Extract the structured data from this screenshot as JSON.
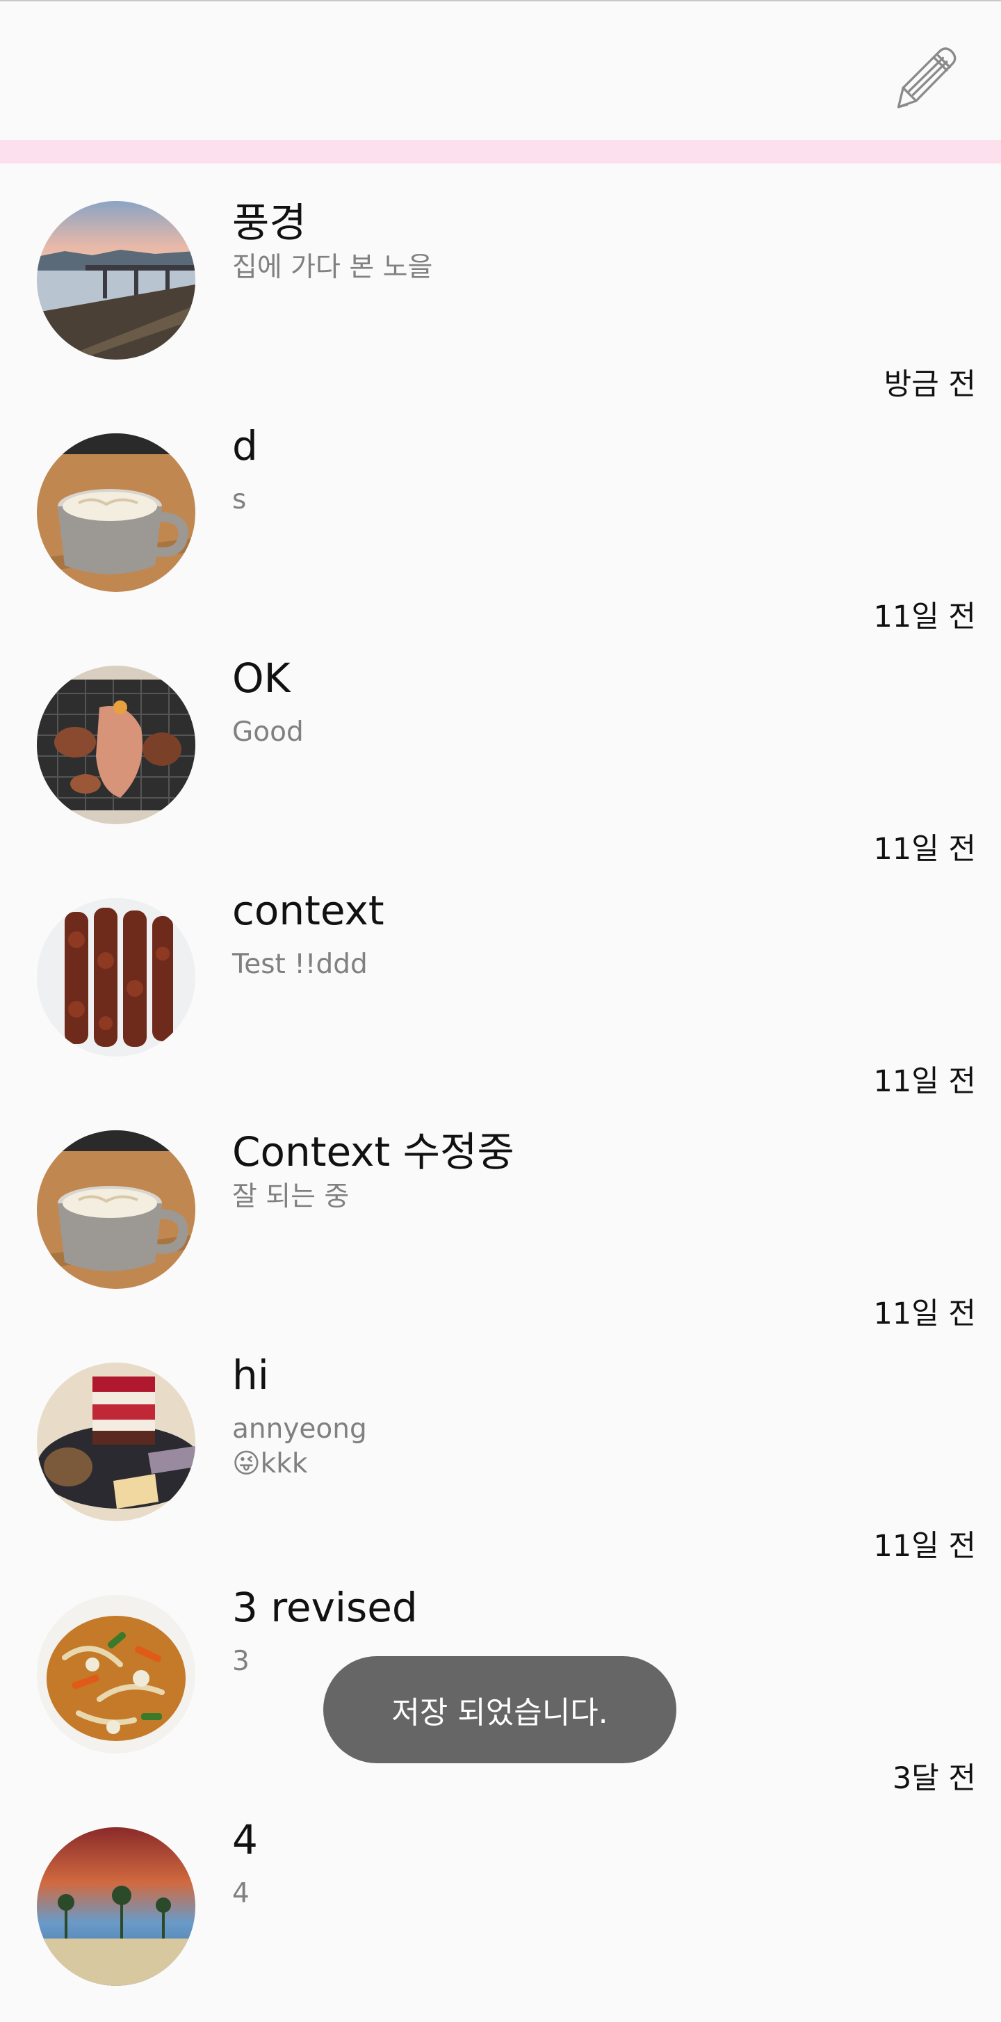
{
  "header": {
    "edit_icon": "pencil-icon"
  },
  "colors": {
    "accent_bar": "#fde0ee",
    "background": "#fafafa",
    "toast": "#666666",
    "subtitle": "#808080"
  },
  "posts": [
    {
      "title": "풍경",
      "content": "집에 가다 본 노을",
      "time": "방금 전",
      "image": "sunset-bridge-photo"
    },
    {
      "title": "d",
      "content": "s",
      "time": "11일 전",
      "image": "coffee-cup-photo"
    },
    {
      "title": "OK",
      "content": "Good",
      "time": "11일 전",
      "image": "grilled-meat-photo"
    },
    {
      "title": "context",
      "content": "Test !!ddd",
      "time": "11일 전",
      "image": "skewers-photo"
    },
    {
      "title": "Context 수정중",
      "content": "잘 되는 중",
      "time": "11일 전",
      "image": "coffee-cup-photo"
    },
    {
      "title": "hi",
      "content": "annyeong\n😜kkk",
      "time": "11일 전",
      "image": "cake-dessert-photo"
    },
    {
      "title": "3 revised",
      "content": "3",
      "time": "3달 전",
      "image": "stir-fry-dish-photo"
    },
    {
      "title": "4",
      "content": "4",
      "time": "",
      "image": "beach-resort-photo"
    }
  ],
  "toast": {
    "message": "저장 되었습니다."
  }
}
